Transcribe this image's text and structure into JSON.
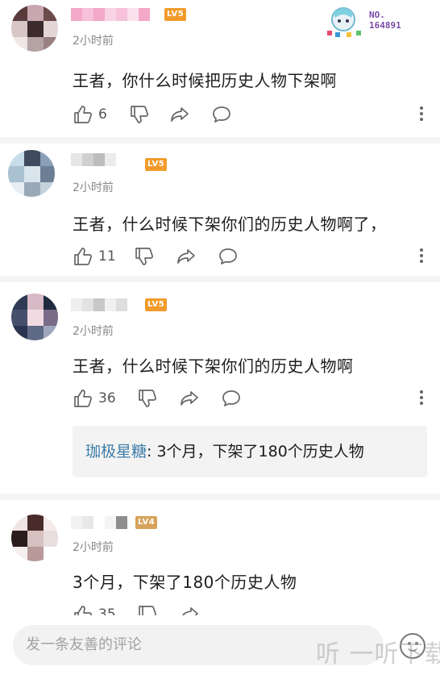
{
  "comments": [
    {
      "level": "LV5",
      "time": "2小时前",
      "text": "王者，你什么时候把历史人物下架啊",
      "likes": "6"
    },
    {
      "level": "LV5",
      "time": "2小时前",
      "text": "王者，什么时候下架你们的历史人物啊了，",
      "likes": "11"
    },
    {
      "level": "LV5",
      "time": "2小时前",
      "text": "王者，什么时候下架你们的历史人物啊",
      "likes": "36",
      "reply": {
        "name": "珈极星糖",
        "text": ": 3个月，下架了180个历史人物"
      }
    },
    {
      "level": "LV4",
      "time": "2小时前",
      "text": "3个月，下架了180个历史人物",
      "likes": "35"
    }
  ],
  "badge": {
    "line1": "NO.",
    "line2": "164891"
  },
  "input": {
    "placeholder": "发一条友善的评论"
  },
  "watermark": "听 一听下载",
  "icons": [
    "like-icon",
    "dislike-icon",
    "share-icon",
    "comment-icon",
    "more-icon",
    "emoji-icon"
  ],
  "colors": {
    "level_badge": "#f29b2a",
    "reply_name": "#3d7da8",
    "divider": "#f4f4f4"
  }
}
